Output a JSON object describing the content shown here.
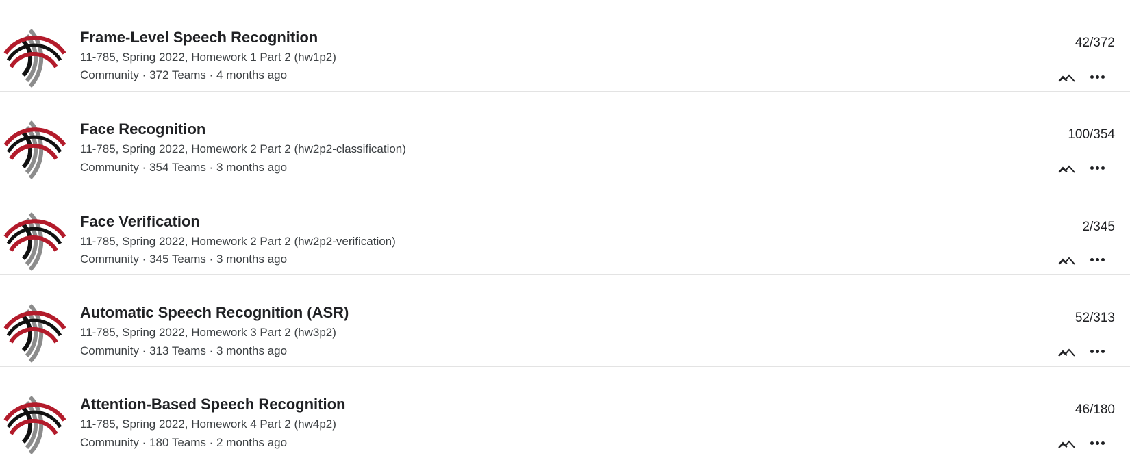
{
  "colors": {
    "logo_red": "#b31b2b",
    "logo_gray": "#8c8c8c",
    "logo_black": "#111111",
    "divider": "#e3e3e3"
  },
  "icons": {
    "thumbnail": "cmu-wave-logo",
    "chart": "chart-line-icon",
    "more": "more-horizontal-icon"
  },
  "competitions": [
    {
      "title": "Frame-Level Speech Recognition",
      "subtitle": "11-785, Spring 2022, Homework 1 Part 2 (hw1p2)",
      "meta": "Community · 372 Teams · 4 months ago",
      "rank": "42/372"
    },
    {
      "title": "Face Recognition",
      "subtitle": "11-785, Spring 2022, Homework 2 Part 2 (hw2p2-classification)",
      "meta": "Community · 354 Teams · 3 months ago",
      "rank": "100/354"
    },
    {
      "title": "Face Verification",
      "subtitle": "11-785, Spring 2022, Homework 2 Part 2 (hw2p2-verification)",
      "meta": "Community · 345 Teams · 3 months ago",
      "rank": "2/345"
    },
    {
      "title": "Automatic Speech Recognition (ASR)",
      "subtitle": "11-785, Spring 2022, Homework 3 Part 2 (hw3p2)",
      "meta": "Community · 313 Teams · 3 months ago",
      "rank": "52/313"
    },
    {
      "title": "Attention-Based Speech Recognition",
      "subtitle": "11-785, Spring 2022, Homework 4 Part 2 (hw4p2)",
      "meta": "Community · 180 Teams · 2 months ago",
      "rank": "46/180"
    }
  ]
}
